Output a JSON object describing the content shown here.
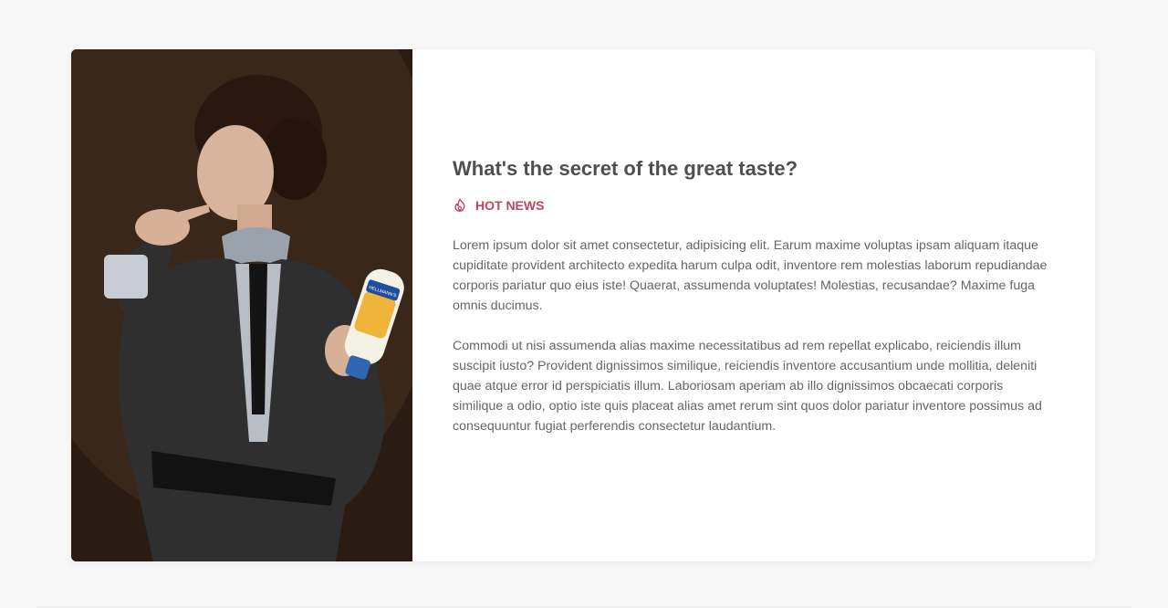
{
  "article": {
    "title": "What's the secret of the great taste?",
    "category_label": "HOT NEWS",
    "category_icon": "fire-icon",
    "paragraphs": [
      "Lorem ipsum dolor sit amet consectetur, adipisicing elit. Earum maxime voluptas ipsam aliquam itaque cupiditate provident architecto expedita harum culpa odit, inventore rem molestias laborum repudiandae corporis pariatur quo eius iste! Quaerat, assumenda voluptates! Molestias, recusandae? Maxime fuga omnis ducimus.",
      "Commodi ut nisi assumenda alias maxime necessitatibus ad rem repellat explicabo, reiciendis illum suscipit iusto? Provident dignissimos similique, reiciendis inventore accusantium unde mollitia, deleniti quae atque error id perspiciatis illum. Laboriosam aperiam ab illo dignissimos obcaecati corporis similique a odio, optio iste quis placeat alias amet rerum sint quos dolor pariatur inventore possimus ad consequuntur fugiat perferendis consectetur laudantium."
    ],
    "image_brand_text": "HELLMANN'S"
  },
  "colors": {
    "accent": "#c2455b",
    "title": "#4f4f4f",
    "text": "#666666",
    "background": "#f8f8f8",
    "card": "#ffffff"
  }
}
